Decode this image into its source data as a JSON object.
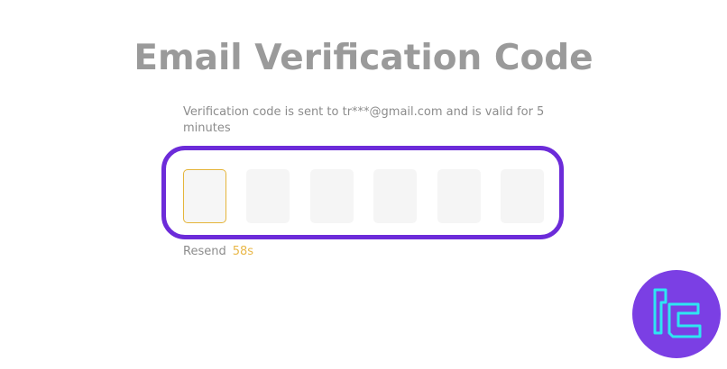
{
  "page": {
    "title": "Email Verification Code",
    "subtitle": "Verification code is sent to tr***@gmail.com and is valid for 5 minutes"
  },
  "code_input": {
    "digits": [
      "",
      "",
      "",
      "",
      "",
      ""
    ],
    "active_index": 0
  },
  "resend": {
    "label": "Resend",
    "timer": "58s"
  },
  "colors": {
    "title": "#9a9a9a",
    "highlight_frame": "#6c2bd9",
    "active_box_border": "#e5b53a",
    "timer": "#e9b84a",
    "logo_bg": "#7b3fe4",
    "logo_mark": "#2ee6f2"
  },
  "icons": {
    "brand_logo": "tc-logo-icon"
  }
}
